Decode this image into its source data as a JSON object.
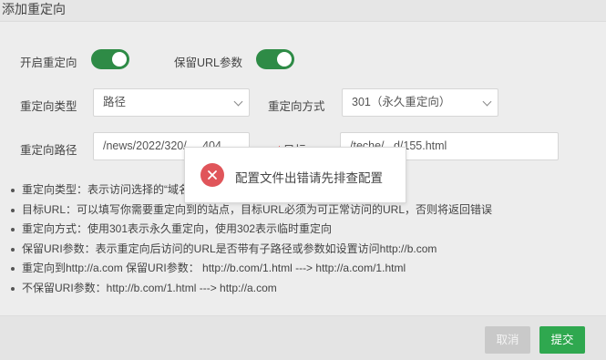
{
  "dialog": {
    "title": "添加重定向"
  },
  "form": {
    "enable_label": "开启重定向",
    "enable_on": true,
    "keep_params_label": "保留URL参数",
    "keep_params_on": true,
    "type_label": "重定向类型",
    "type_value": "路径",
    "method_label": "重定向方式",
    "method_value": "301（永久重定向）",
    "path_label": "重定向路径",
    "path_value": "/news/2022/320/.....404",
    "target_label_required_mark": "*",
    "target_label": "目标",
    "target_value": "/teche/ ..d/155.html"
  },
  "help": [
    "重定向类型：表示访问选择的“域名”或输入的“路径”重定向到指定URL",
    "目标URL：可以填写你需要重定向到的站点，目标URL必须为可正常访问的URL，否则将返回错误",
    "重定向方式：使用301表示永久重定向，使用302表示临时重定向",
    "保留URI参数：表示重定向后访问的URL是否带有子路径或参数如设置访问http://b.com",
    "重定向到http://a.com 保留URI参数： http://b.com/1.html ---> http://a.com/1.html",
    "不保留URI参数：http://b.com/1.html ---> http://a.com"
  ],
  "buttons": {
    "cancel": "取消",
    "submit": "提交"
  },
  "toast": {
    "message": "配置文件出错请先排查配置",
    "icon": "error-x-icon"
  },
  "colors": {
    "toggle_on": "#2e8b46",
    "submit": "#2fa84f",
    "error": "#e0555a"
  }
}
